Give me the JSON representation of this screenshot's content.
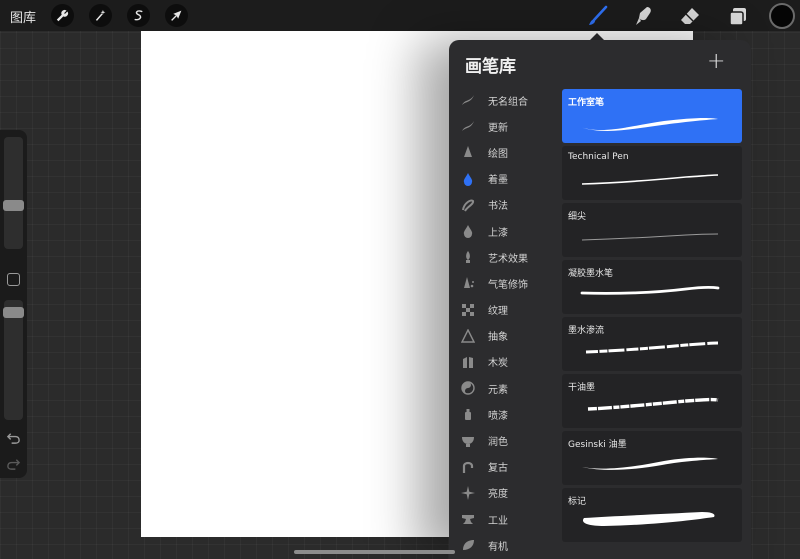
{
  "topbar": {
    "gallery_label": "图库",
    "left_tools": [
      "wrench-icon",
      "magic-wand-icon",
      "selection-icon",
      "transform-arrow-icon"
    ],
    "right_tools": [
      "brush-icon",
      "smudge-icon",
      "eraser-icon",
      "layers-icon"
    ],
    "active_tool": "brush-icon",
    "accent_color": "#2f71f5",
    "current_color": "#000000"
  },
  "sidebar": {
    "brush_size_slider": "size-slider",
    "opacity_slider": "opacity-slider",
    "undo_icon": "undo-icon",
    "redo_icon": "redo-icon"
  },
  "brush_library": {
    "title": "画笔库",
    "add_label": "+",
    "categories": [
      {
        "label": "无名组合",
        "icon": "stroke-icon"
      },
      {
        "label": "更新",
        "icon": "stroke-icon"
      },
      {
        "label": "绘图",
        "icon": "pencil-tip-icon"
      },
      {
        "label": "着墨",
        "icon": "ink-drop-icon",
        "active": true
      },
      {
        "label": "书法",
        "icon": "calligraphy-icon"
      },
      {
        "label": "上漆",
        "icon": "paint-drop-icon"
      },
      {
        "label": "艺术效果",
        "icon": "brush-tip-icon"
      },
      {
        "label": "气笔修饰",
        "icon": "airbrush-icon"
      },
      {
        "label": "纹理",
        "icon": "texture-icon"
      },
      {
        "label": "抽象",
        "icon": "triangle-icon"
      },
      {
        "label": "木炭",
        "icon": "charcoal-icon"
      },
      {
        "label": "元素",
        "icon": "yin-yang-icon"
      },
      {
        "label": "喷漆",
        "icon": "spray-can-icon"
      },
      {
        "label": "润色",
        "icon": "bowl-icon"
      },
      {
        "label": "复古",
        "icon": "retro-icon"
      },
      {
        "label": "亮度",
        "icon": "sparkle-icon"
      },
      {
        "label": "工业",
        "icon": "anvil-icon"
      },
      {
        "label": "有机",
        "icon": "leaf-icon"
      }
    ],
    "brushes": [
      {
        "name": "工作室笔",
        "selected": true
      },
      {
        "name": "Technical Pen"
      },
      {
        "name": "细尖"
      },
      {
        "name": "凝胶墨水笔"
      },
      {
        "name": "墨水渗流"
      },
      {
        "name": "干油墨"
      },
      {
        "name": "Gesinski 油墨"
      },
      {
        "name": "标记"
      }
    ]
  }
}
